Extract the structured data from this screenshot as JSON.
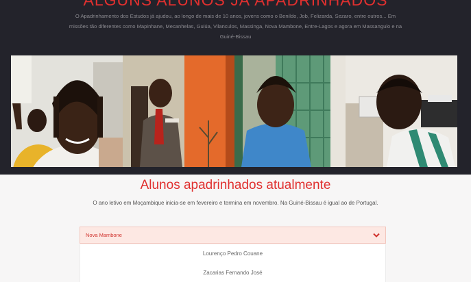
{
  "hero": {
    "title": "ALGUNS ALUNOS JÁ APADRINHADOS",
    "text": "O Apadrinhamento dos Estudos já ajudou, ao longo de mais de 10 anos, jovens como o Benildo, Job, Felizarda, Sezaro, entre outros... Em missões tão diferentes como Mapinhane, Mecanhelas, Guiúa, Vilanculos, Massinga, Nova Mambone, Entre-Lagos e agora em Massangulo e na Guiné-Bissau",
    "photos": [
      "student-photo",
      "student-photo",
      "student-photo",
      "student-photo"
    ]
  },
  "section": {
    "title": "Alunos apadrinhados atualmente",
    "subtitle": "O ano letivo em Moçambique inicia-se em fevereiro e termina em novembro. Na Guiné-Bissau é igual ao de Portugal."
  },
  "accordion": {
    "header": "Nova Mambone",
    "items": [
      "Lourenço Pedro Couane",
      "Zacarias Fernando José"
    ]
  },
  "colors": {
    "accent": "#e0302f",
    "hero_bg": "#23232b"
  }
}
